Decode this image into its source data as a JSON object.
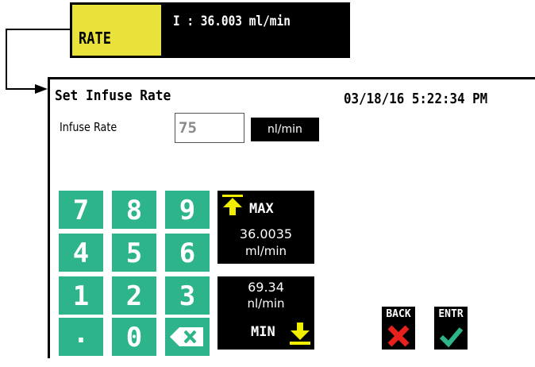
{
  "status_bar": {
    "tab_label": "RATE",
    "current_rate": "I : 36.003 ml/min"
  },
  "screen": {
    "title": "Set Infuse Rate",
    "datetime": "03/18/16 5:22:34 PM",
    "field_label": "Infuse Rate",
    "field_value": "75",
    "unit_label": "nl/min"
  },
  "keypad": {
    "keys": [
      "7",
      "8",
      "9",
      "4",
      "5",
      "6",
      "1",
      "2",
      "3",
      ".",
      "0"
    ],
    "backspace_icon": "backspace-icon"
  },
  "limits": {
    "max_label": "MAX",
    "max_value": "36.0035",
    "max_unit": "ml/min",
    "min_label": "MIN",
    "min_value": "69.34",
    "min_unit": "nl/min"
  },
  "controls": {
    "back_label": "BACK",
    "enter_label": "ENTR"
  },
  "colors": {
    "key_green": "#2eb48a",
    "accent_yellow": "#f2ee00",
    "back_red": "#e8211d",
    "enter_green": "#2eb48a"
  }
}
